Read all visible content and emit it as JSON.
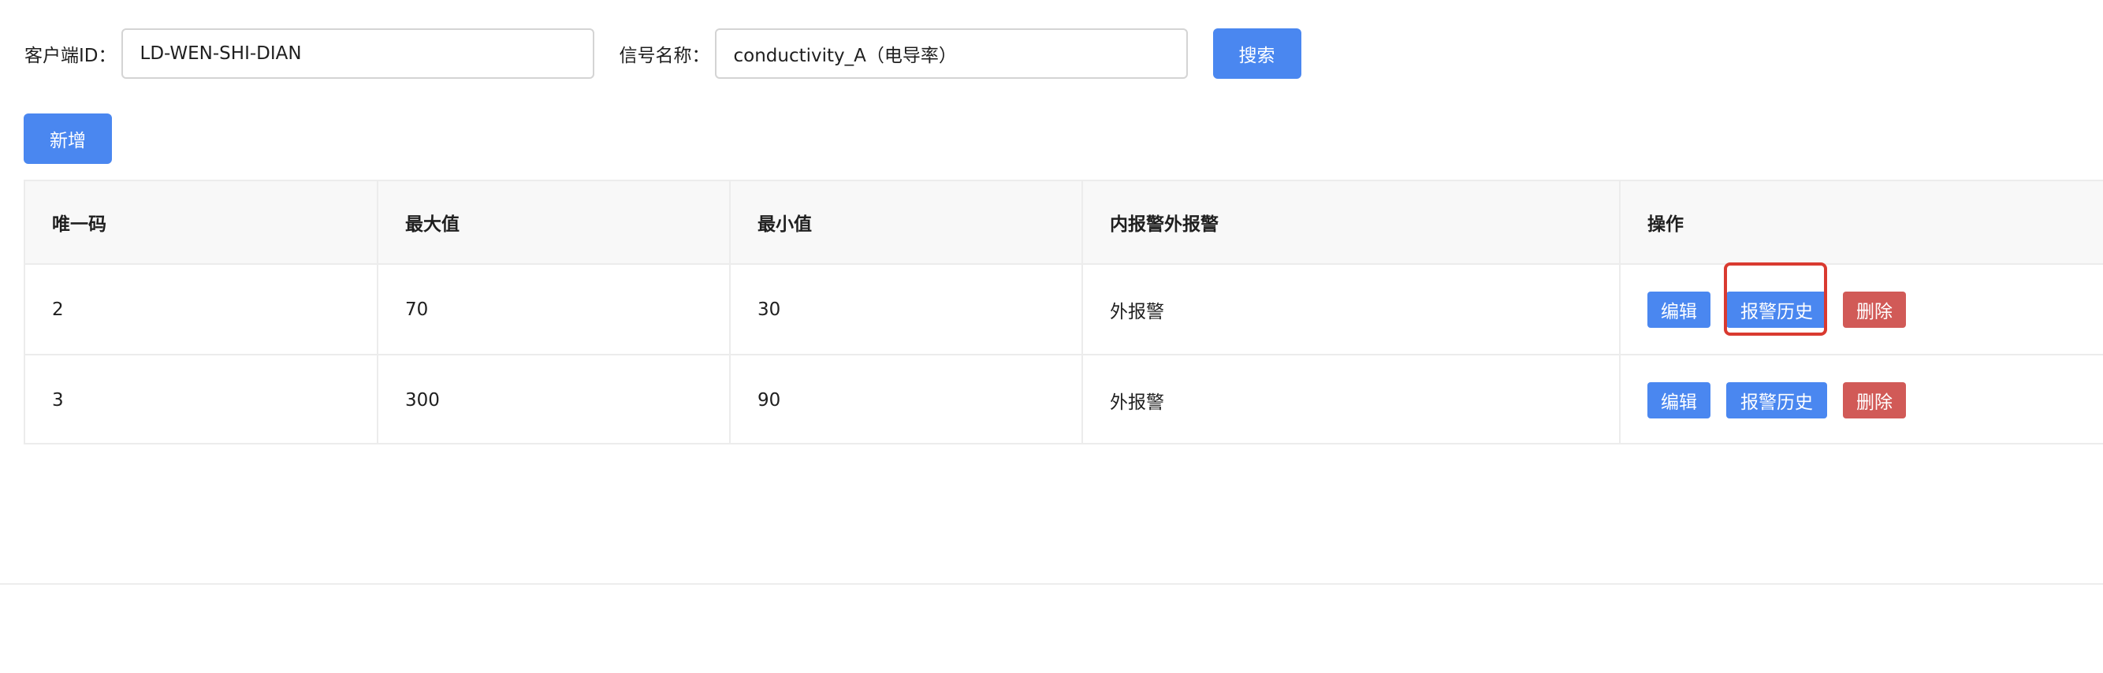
{
  "search": {
    "client_label": "客户端ID：",
    "client_value": "LD-WEN-SHI-DIAN",
    "signal_label": "信号名称：",
    "signal_value": "conductivity_A（电导率）",
    "search_button": "搜索"
  },
  "toolbar": {
    "add_button": "新增"
  },
  "table": {
    "headers": {
      "id": "唯一码",
      "max": "最大值",
      "min": "最小值",
      "alarm_type": "内报警外报警",
      "operations": "操作"
    },
    "rows": [
      {
        "id": "2",
        "max": "70",
        "min": "30",
        "alarm_type": "外报警",
        "edit": "编辑",
        "history": "报警历史",
        "delete": "删除"
      },
      {
        "id": "3",
        "max": "300",
        "min": "90",
        "alarm_type": "外报警",
        "edit": "编辑",
        "history": "报警历史",
        "delete": "删除"
      }
    ]
  },
  "colors": {
    "primary": "#4a87f0",
    "danger": "#d15a57",
    "highlight": "#d93a30",
    "header_bg": "#f8f8f8",
    "border": "#ececec"
  }
}
